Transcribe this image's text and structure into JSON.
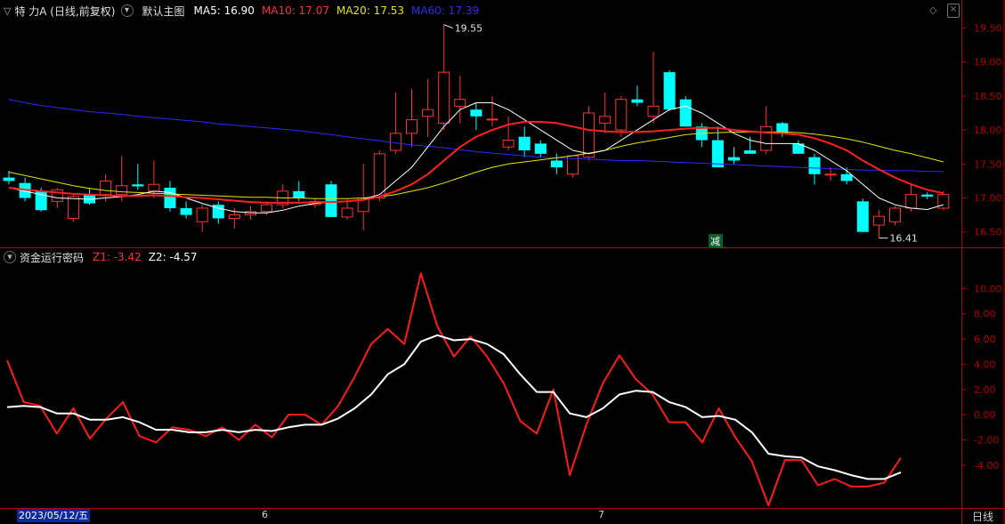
{
  "main_header": {
    "stock_name": "特 力A (日线,前复权)",
    "template_label": "默认主图",
    "ma5": "MA5: 16.90",
    "ma10": "MA10: 17.07",
    "ma20": "MA20: 17.53",
    "ma60": "MA60: 17.39"
  },
  "sub_header": {
    "indicator_name": "资金运行密码",
    "z1": "Z1: -3.42",
    "z2": "Z2: -4.57"
  },
  "bottom_bar": {
    "cursor_date": "2023/05/12/五",
    "month_jun": "6",
    "month_jul": "7",
    "period": "日线"
  },
  "colors": {
    "background": "#000000",
    "frame": "#b00000",
    "up": "#ff3232",
    "down": "#00ffff",
    "ma5": "#ffffff",
    "ma10": "#ff2020",
    "ma20": "#e6e600",
    "ma60": "#2a2aff",
    "z1": "#ff1a1a",
    "z2": "#ffffff"
  },
  "chart_data": [
    {
      "type": "candlestick",
      "title": "",
      "ylim": [
        16.3,
        19.65
      ],
      "yticks": [
        "19.50",
        "19.00",
        "18.50",
        "18.00",
        "17.50",
        "17.00",
        "16.50"
      ],
      "ytick_values": [
        19.5,
        19.0,
        18.5,
        18.0,
        17.5,
        17.0,
        16.5
      ],
      "annotations": {
        "high": "19.55",
        "low": "16.41",
        "marker": "减"
      },
      "ohlc": [
        [
          17.3,
          17.4,
          17.2,
          17.25
        ],
        [
          17.22,
          17.3,
          16.95,
          17.0
        ],
        [
          17.1,
          17.15,
          16.8,
          16.82
        ],
        [
          16.95,
          17.15,
          16.85,
          17.12
        ],
        [
          16.7,
          17.05,
          16.65,
          17.02
        ],
        [
          17.05,
          17.15,
          16.9,
          16.92
        ],
        [
          17.05,
          17.35,
          16.95,
          17.25
        ],
        [
          17.05,
          17.62,
          16.95,
          17.18
        ],
        [
          17.2,
          17.5,
          17.12,
          17.17
        ],
        [
          17.1,
          17.55,
          17.0,
          17.2
        ],
        [
          17.15,
          17.25,
          16.8,
          16.85
        ],
        [
          16.85,
          16.95,
          16.7,
          16.75
        ],
        [
          16.65,
          16.9,
          16.5,
          16.85
        ],
        [
          16.9,
          16.95,
          16.62,
          16.7
        ],
        [
          16.7,
          16.85,
          16.55,
          16.75
        ],
        [
          16.75,
          16.88,
          16.68,
          16.8
        ],
        [
          16.8,
          16.95,
          16.75,
          16.9
        ],
        [
          16.9,
          17.2,
          16.85,
          17.1
        ],
        [
          17.1,
          17.25,
          16.95,
          17.0
        ],
        [
          16.9,
          17.0,
          16.85,
          16.95
        ],
        [
          17.2,
          17.25,
          16.75,
          16.72
        ],
        [
          16.72,
          17.0,
          16.68,
          16.85
        ],
        [
          16.8,
          17.5,
          16.52,
          17.0
        ],
        [
          17.0,
          17.7,
          16.95,
          17.65
        ],
        [
          17.7,
          18.55,
          17.65,
          17.95
        ],
        [
          17.95,
          18.6,
          17.75,
          18.15
        ],
        [
          18.2,
          18.75,
          17.9,
          18.3
        ],
        [
          18.1,
          19.55,
          18.0,
          18.85
        ],
        [
          18.35,
          18.8,
          18.1,
          18.45
        ],
        [
          18.3,
          18.4,
          18.0,
          18.2
        ],
        [
          18.15,
          18.5,
          18.05,
          18.16
        ],
        [
          17.75,
          18.2,
          17.7,
          17.85
        ],
        [
          17.9,
          18.05,
          17.6,
          17.7
        ],
        [
          17.8,
          17.85,
          17.6,
          17.65
        ],
        [
          17.55,
          17.65,
          17.35,
          17.45
        ],
        [
          17.35,
          17.6,
          17.3,
          17.62
        ],
        [
          17.6,
          18.35,
          17.55,
          18.25
        ],
        [
          18.1,
          18.55,
          17.95,
          18.2
        ],
        [
          18.0,
          18.5,
          17.9,
          18.45
        ],
        [
          18.45,
          18.65,
          18.35,
          18.4
        ],
        [
          18.2,
          19.15,
          18.1,
          18.35
        ],
        [
          18.85,
          18.88,
          18.28,
          18.3
        ],
        [
          18.45,
          18.5,
          18.08,
          18.05
        ],
        [
          18.05,
          18.1,
          17.75,
          17.85
        ],
        [
          17.85,
          18.05,
          17.45,
          17.45
        ],
        [
          17.6,
          17.75,
          17.5,
          17.55
        ],
        [
          17.7,
          17.9,
          17.65,
          17.65
        ],
        [
          17.7,
          18.35,
          17.65,
          18.05
        ],
        [
          18.1,
          18.12,
          17.9,
          17.95
        ],
        [
          17.8,
          17.85,
          17.65,
          17.65
        ],
        [
          17.6,
          17.65,
          17.2,
          17.35
        ],
        [
          17.35,
          17.45,
          17.25,
          17.35
        ],
        [
          17.35,
          17.45,
          17.2,
          17.25
        ],
        [
          16.95,
          16.99,
          16.5,
          16.5
        ],
        [
          16.6,
          16.82,
          16.41,
          16.73
        ],
        [
          16.65,
          16.88,
          16.6,
          16.85
        ],
        [
          16.85,
          17.2,
          16.8,
          17.05
        ],
        [
          17.05,
          17.08,
          16.98,
          17.02
        ],
        [
          16.85,
          17.1,
          16.82,
          17.05
        ]
      ],
      "ma5": [
        17.15,
        17.1,
        17.05,
        17.0,
        16.99,
        16.98,
        17.0,
        17.02,
        17.05,
        17.1,
        17.08,
        17.0,
        16.92,
        16.85,
        16.8,
        16.78,
        16.78,
        16.82,
        16.88,
        16.92,
        16.94,
        16.95,
        16.98,
        17.05,
        17.25,
        17.45,
        17.75,
        18.05,
        18.3,
        18.4,
        18.4,
        18.3,
        18.15,
        18.0,
        17.85,
        17.7,
        17.65,
        17.7,
        17.85,
        18.0,
        18.15,
        18.3,
        18.35,
        18.25,
        18.1,
        17.95,
        17.85,
        17.8,
        17.8,
        17.8,
        17.7,
        17.55,
        17.4,
        17.2,
        17.0,
        16.9,
        16.85,
        16.83,
        16.9
      ],
      "ma10": [
        17.15,
        17.12,
        17.1,
        17.08,
        17.06,
        17.05,
        17.04,
        17.03,
        17.03,
        17.04,
        17.03,
        17.01,
        17.0,
        16.98,
        16.96,
        16.94,
        16.93,
        16.93,
        16.93,
        16.94,
        16.94,
        16.95,
        16.97,
        17.02,
        17.1,
        17.2,
        17.35,
        17.55,
        17.75,
        17.9,
        18.0,
        18.08,
        18.12,
        18.12,
        18.1,
        18.05,
        18.0,
        17.98,
        17.97,
        17.97,
        17.98,
        18.0,
        18.02,
        18.03,
        18.03,
        18.0,
        17.98,
        17.96,
        17.95,
        17.93,
        17.88,
        17.8,
        17.7,
        17.55,
        17.42,
        17.3,
        17.2,
        17.12,
        17.07
      ],
      "ma20": [
        17.38,
        17.33,
        17.28,
        17.23,
        17.18,
        17.14,
        17.11,
        17.09,
        17.08,
        17.07,
        17.06,
        17.05,
        17.04,
        17.03,
        17.02,
        17.01,
        17.01,
        17.0,
        17.0,
        16.99,
        16.99,
        16.99,
        17.0,
        17.02,
        17.05,
        17.1,
        17.15,
        17.22,
        17.3,
        17.38,
        17.45,
        17.5,
        17.53,
        17.56,
        17.59,
        17.62,
        17.66,
        17.7,
        17.76,
        17.81,
        17.85,
        17.89,
        17.93,
        17.95,
        17.96,
        17.97,
        17.97,
        17.97,
        17.97,
        17.96,
        17.94,
        17.91,
        17.87,
        17.82,
        17.76,
        17.7,
        17.65,
        17.59,
        17.53
      ],
      "ma60": [
        18.45,
        18.4,
        18.36,
        18.33,
        18.3,
        18.27,
        18.25,
        18.23,
        18.2,
        18.18,
        18.16,
        18.14,
        18.12,
        18.09,
        18.07,
        18.05,
        18.03,
        18.01,
        17.99,
        17.96,
        17.93,
        17.9,
        17.87,
        17.84,
        17.81,
        17.78,
        17.76,
        17.74,
        17.71,
        17.68,
        17.66,
        17.64,
        17.62,
        17.6,
        17.59,
        17.58,
        17.57,
        17.56,
        17.55,
        17.55,
        17.54,
        17.53,
        17.52,
        17.51,
        17.5,
        17.49,
        17.48,
        17.47,
        17.46,
        17.45,
        17.44,
        17.43,
        17.42,
        17.41,
        17.41,
        17.4,
        17.4,
        17.39,
        17.39
      ]
    },
    {
      "type": "line",
      "title": "",
      "ylim": [
        -7.4,
        12.0
      ],
      "yticks": [
        "10.00",
        "8.00",
        "6.00",
        "4.00",
        "2.00",
        "0.00",
        "-2.00",
        "-4.00"
      ],
      "ytick_values": [
        10,
        8,
        6,
        4,
        2,
        0,
        -2,
        -4
      ],
      "series": [
        {
          "name": "Z1",
          "values": [
            4.3,
            1.0,
            0.7,
            -1.5,
            0.5,
            -1.9,
            -0.3,
            1.0,
            -1.7,
            -2.2,
            -1.0,
            -1.2,
            -1.7,
            -1.0,
            -2.0,
            -0.8,
            -1.8,
            0.0,
            0.0,
            -0.8,
            0.7,
            3.0,
            5.6,
            6.8,
            5.6,
            11.2,
            7.0,
            4.6,
            6.2,
            4.6,
            2.5,
            -0.5,
            -1.5,
            2.0,
            -4.8,
            -0.8,
            2.5,
            4.7,
            2.8,
            1.6,
            -0.6,
            -0.6,
            -2.2,
            0.5,
            -1.8,
            -3.7,
            -7.2,
            -3.6,
            -3.6,
            -5.6,
            -5.1,
            -5.7,
            -5.7,
            -5.4,
            -3.42
          ]
        },
        {
          "name": "Z2",
          "values": [
            0.6,
            0.7,
            0.6,
            0.1,
            0.1,
            -0.4,
            -0.4,
            -0.2,
            -0.6,
            -1.2,
            -1.2,
            -1.4,
            -1.4,
            -1.2,
            -1.4,
            -1.2,
            -1.3,
            -1.0,
            -0.8,
            -0.8,
            -0.3,
            0.5,
            1.6,
            3.2,
            4.0,
            5.8,
            6.3,
            5.9,
            6.0,
            5.6,
            4.8,
            3.2,
            1.8,
            1.8,
            0.1,
            -0.2,
            0.5,
            1.6,
            1.9,
            1.8,
            1.0,
            0.6,
            -0.2,
            -0.1,
            -0.4,
            -1.4,
            -3.1,
            -3.3,
            -3.4,
            -4.1,
            -4.4,
            -4.8,
            -5.1,
            -5.1,
            -4.57
          ]
        }
      ]
    }
  ]
}
